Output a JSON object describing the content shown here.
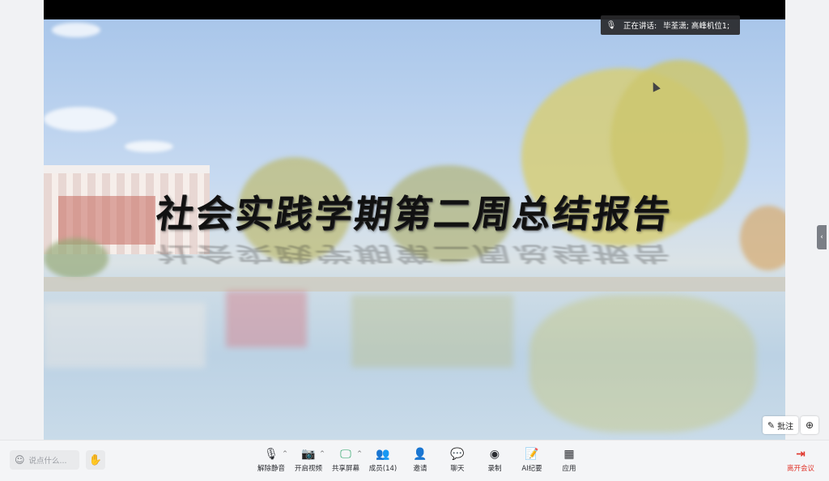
{
  "slide": {
    "title": "社会实践学期第二周总结报告"
  },
  "speaker": {
    "icon": "mic-icon",
    "label": "正在讲话:",
    "name": "毕荃潇; 高峰机位1;"
  },
  "annotation": {
    "label": "批注",
    "icon": "pen-icon"
  },
  "zoom": {
    "icon": "zoom-in-icon"
  },
  "chat": {
    "placeholder": "说点什么...",
    "icon": "smile-icon"
  },
  "hand": {
    "icon": "raise-hand-icon"
  },
  "toolbar": {
    "items": [
      {
        "label": "解除静音",
        "icon": "mic-off-icon",
        "glyph": "🎙",
        "caret": true
      },
      {
        "label": "开启视频",
        "icon": "camera-off-icon",
        "glyph": "📷",
        "caret": true
      },
      {
        "label": "共享屏幕",
        "icon": "share-screen-icon",
        "glyph": "🖵",
        "caret": true
      },
      {
        "label": "成员(14)",
        "icon": "members-icon",
        "glyph": "👥",
        "caret": false
      },
      {
        "label": "邀请",
        "icon": "invite-icon",
        "glyph": "👤",
        "caret": false
      },
      {
        "label": "聊天",
        "icon": "chat-icon",
        "glyph": "💬",
        "caret": false
      },
      {
        "label": "录制",
        "icon": "record-icon",
        "glyph": "◉",
        "caret": false
      },
      {
        "label": "AI纪要",
        "icon": "ai-notes-icon",
        "glyph": "📝",
        "caret": false
      },
      {
        "label": "应用",
        "icon": "apps-icon",
        "glyph": "▦",
        "caret": false
      }
    ],
    "leave_label": "离开会议",
    "leave_icon": "exit-icon"
  },
  "colors": {
    "accent_red": "#e0352b",
    "speaker_bg": "#28282a"
  }
}
